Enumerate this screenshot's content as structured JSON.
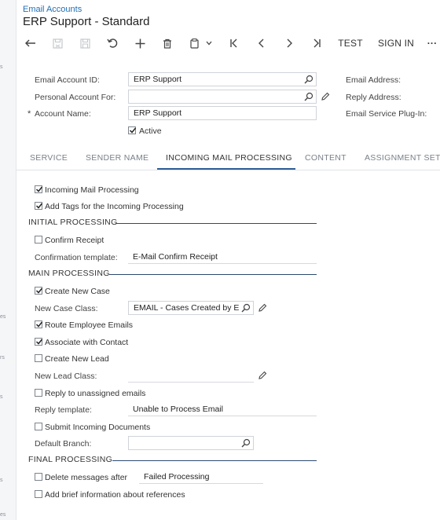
{
  "breadcrumb": "Email Accounts",
  "page_title": "ERP Support - Standard",
  "left_rail_fragments": [
    "s",
    "es",
    "rs",
    "s",
    "s",
    "es"
  ],
  "toolbar": {
    "test_label": "TEST",
    "sign_in_label": "SIGN IN",
    "more_label": "···",
    "icons": [
      "undo-arrow-icon",
      "save-close-icon",
      "save-icon",
      "cancel-icon",
      "add-icon",
      "delete-icon",
      "copy-paste-icon",
      "first-record-icon",
      "previous-record-icon",
      "next-record-icon",
      "last-record-icon"
    ]
  },
  "form": {
    "email_account_id_label": "Email Account ID:",
    "email_account_id_value": "ERP Support",
    "personal_account_for_label": "Personal Account For:",
    "personal_account_for_value": "",
    "account_name_label": "Account Name:",
    "account_name_value": "ERP Support",
    "required_marker": "*",
    "active_label": "Active",
    "active_checked": true,
    "email_address_label": "Email Address:",
    "reply_address_label": "Reply Address:",
    "email_service_plugin_label": "Email Service Plug-In:"
  },
  "tabs": [
    {
      "label": "SERVICE",
      "active": false
    },
    {
      "label": "SENDER NAME",
      "active": false
    },
    {
      "label": "INCOMING MAIL PROCESSING",
      "active": true
    },
    {
      "label": "CONTENT",
      "active": false
    },
    {
      "label": "ASSIGNMENT SETT",
      "active": false
    }
  ],
  "incoming": {
    "incoming_mail_processing_label": "Incoming Mail Processing",
    "incoming_mail_processing_checked": true,
    "add_tags_label": "Add Tags for the Incoming Processing",
    "add_tags_checked": true,
    "initial_processing_title": "INITIAL PROCESSING",
    "confirm_receipt_label": "Confirm Receipt",
    "confirm_receipt_checked": false,
    "confirmation_template_label": "Confirmation template:",
    "confirmation_template_value": "E-Mail Confirm Receipt",
    "main_processing_title": "MAIN PROCESSING",
    "create_new_case_label": "Create New Case",
    "create_new_case_checked": true,
    "new_case_class_label": "New Case Class:",
    "new_case_class_value": "EMAIL - Cases Created by Er",
    "route_employee_emails_label": "Route Employee Emails",
    "route_employee_emails_checked": true,
    "associate_with_contact_label": "Associate with Contact",
    "associate_with_contact_checked": true,
    "create_new_lead_label": "Create New Lead",
    "create_new_lead_checked": false,
    "new_lead_class_label": "New Lead Class:",
    "new_lead_class_value": "",
    "reply_unassigned_label": "Reply to unassigned emails",
    "reply_unassigned_checked": false,
    "reply_template_label": "Reply template:",
    "reply_template_value": "Unable to Process Email",
    "submit_incoming_docs_label": "Submit Incoming Documents",
    "submit_incoming_docs_checked": false,
    "default_branch_label": "Default Branch:",
    "default_branch_value": "",
    "final_processing_title": "FINAL PROCESSING",
    "delete_messages_label": "Delete messages after",
    "delete_messages_checked": false,
    "delete_messages_value": "Failed Processing",
    "add_brief_info_label": "Add brief information about references",
    "add_brief_info_checked": false
  },
  "colors": {
    "accent": "#2d5d95",
    "link": "#1f6fb5",
    "border": "#cfd3d8"
  }
}
